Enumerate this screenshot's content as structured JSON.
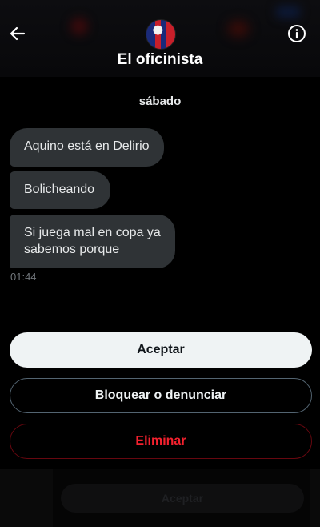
{
  "header": {
    "title": "El oficinista",
    "back_icon": "arrow-left-icon",
    "info_icon": "info-circle-icon"
  },
  "conversation": {
    "date_separator": "sábado",
    "messages": [
      {
        "text": "Aquino está en Delirio"
      },
      {
        "text": "Bolicheando"
      },
      {
        "text": "Si juega mal en copa ya sabemos porque"
      }
    ],
    "last_timestamp": "01:44"
  },
  "actions": {
    "accept_label": "Aceptar",
    "block_report_label": "Bloquear o denunciar",
    "delete_label": "Eliminar"
  },
  "background": {
    "ghost_button_label": "Aceptar"
  },
  "colors": {
    "background": "#000000",
    "bubble": "#2f3336",
    "accept_bg": "#eff3f4",
    "danger": "#f4212e"
  }
}
